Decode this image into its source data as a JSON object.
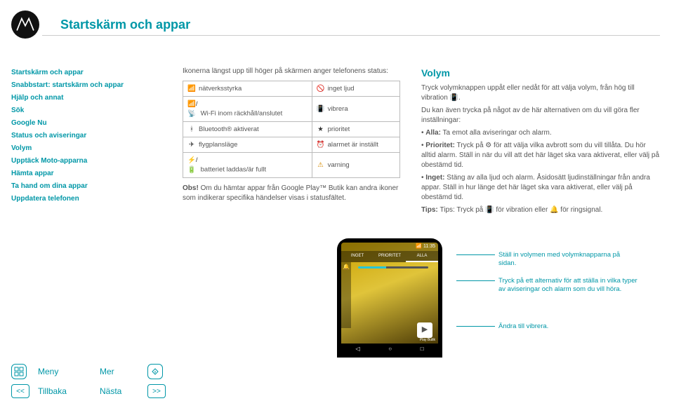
{
  "header": {
    "title": "Startskärm och appar"
  },
  "sidebar": {
    "items": [
      "Startskärm och appar",
      "Snabbstart: startskärm och appar",
      "Hjälp och annat",
      "Sök",
      "Google Nu",
      "Status och aviseringar",
      "Volym",
      "Upptäck Moto-apparna",
      "Hämta appar",
      "Ta hand om dina appar",
      "Uppdatera telefonen"
    ]
  },
  "mid": {
    "intro": "Ikonerna längst upp till höger på skärmen anger telefonens status:",
    "table": [
      {
        "l_ic": "📶",
        "l": "nätverksstyrka",
        "r_ic": "🚫",
        "r": "inget ljud"
      },
      {
        "l_ic": "📶/📡",
        "l": " Wi-Fi inom räckhåll/anslutet",
        "r_ic": "📳",
        "r": "vibrera"
      },
      {
        "l_ic": "ᚼ",
        "l": "Bluetooth® aktiverat",
        "r_ic": "★",
        "r": "prioritet"
      },
      {
        "l_ic": "✈",
        "l": "flygplansläge",
        "r_ic": "⏰",
        "r": "alarmet är inställt"
      },
      {
        "l_ic": "⚡/🔋",
        "l": " batteriet laddas/är fullt",
        "r_ic": "⚠",
        "r": "varning"
      }
    ],
    "obs": "Obs! Om du hämtar appar från Google Play™ Butik kan andra ikoner som indikerar specifika händelser visas i statusfältet."
  },
  "right": {
    "heading": "Volym",
    "p1a": "Tryck volymknappen uppåt eller nedåt för att välja volym, från hög till vibration ",
    "p1_icon": "📳",
    "p1b": ".",
    "p2": "Du kan även trycka på något av de här alternativen om du vill göra fler inställningar:",
    "bullets": [
      {
        "b": "Alla:",
        "t": " Ta emot alla aviseringar och alarm."
      },
      {
        "b": "Prioritet:",
        "t": " Tryck på ⚙ för att välja vilka avbrott som du vill tillåta. Du hör alltid alarm. Ställ in när du vill att det här läget ska vara aktiverat, eller välj på obestämd tid."
      },
      {
        "b": "Inget:",
        "t": " Stäng av alla ljud och alarm. Åsidosätt ljudinställningar från andra appar. Ställ in hur länge det här läget ska vara aktiverat, eller välj på obestämd tid."
      }
    ],
    "tips": "Tips: Tryck på 📳 för vibration eller 🔔 för ringsignal."
  },
  "phone": {
    "time": "📶 11:35",
    "tabs": [
      "INGET",
      "PRIORITET",
      "ALLA"
    ],
    "bell": "🔔",
    "play_icon": "▶",
    "play_label": "Play Butik",
    "nav": [
      "◁",
      "○",
      "□"
    ]
  },
  "annotations": {
    "a1": "Ställ in volymen med volymknapparna på sidan.",
    "a2": "Tryck på ett alternativ för att ställa in vilka typer av aviseringar och alarm som du vill höra.",
    "a3": "Ändra till vibrera."
  },
  "footer": {
    "menu": "Meny",
    "more": "Mer",
    "back": "Tillbaka",
    "next": "Nästa",
    "back_btn": "<<",
    "next_btn": ">>"
  }
}
